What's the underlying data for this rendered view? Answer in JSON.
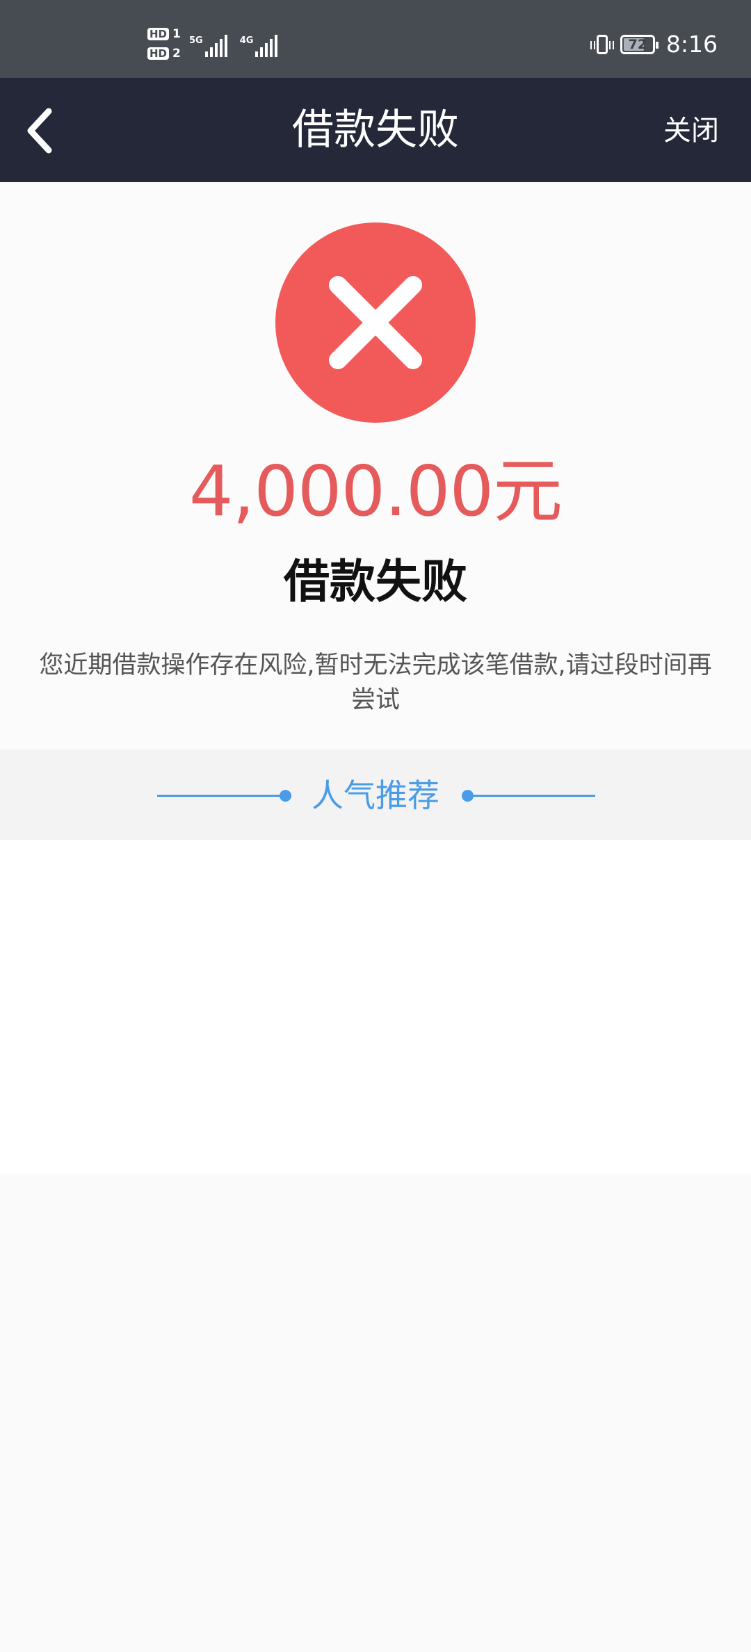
{
  "status_bar": {
    "sim1_badge": "HD",
    "sim1_num": "1",
    "sim2_badge": "HD",
    "sim2_num": "2",
    "network1": "5G",
    "network2": "4G",
    "battery_level": "72",
    "time": "8:16"
  },
  "nav": {
    "back_icon": "chevron-left-icon",
    "title": "借款失败",
    "close_label": "关闭"
  },
  "result": {
    "status_icon": "close-circle-icon",
    "icon_color": "#f25a5a",
    "amount": "4,000.00元",
    "amount_color": "#e55a5a",
    "title": "借款失败",
    "message": "您近期借款操作存在风险,暂时无法完成该笔借款,请过段时间再尝试"
  },
  "recommend": {
    "label": "人气推荐",
    "accent_color": "#4a9be8"
  }
}
